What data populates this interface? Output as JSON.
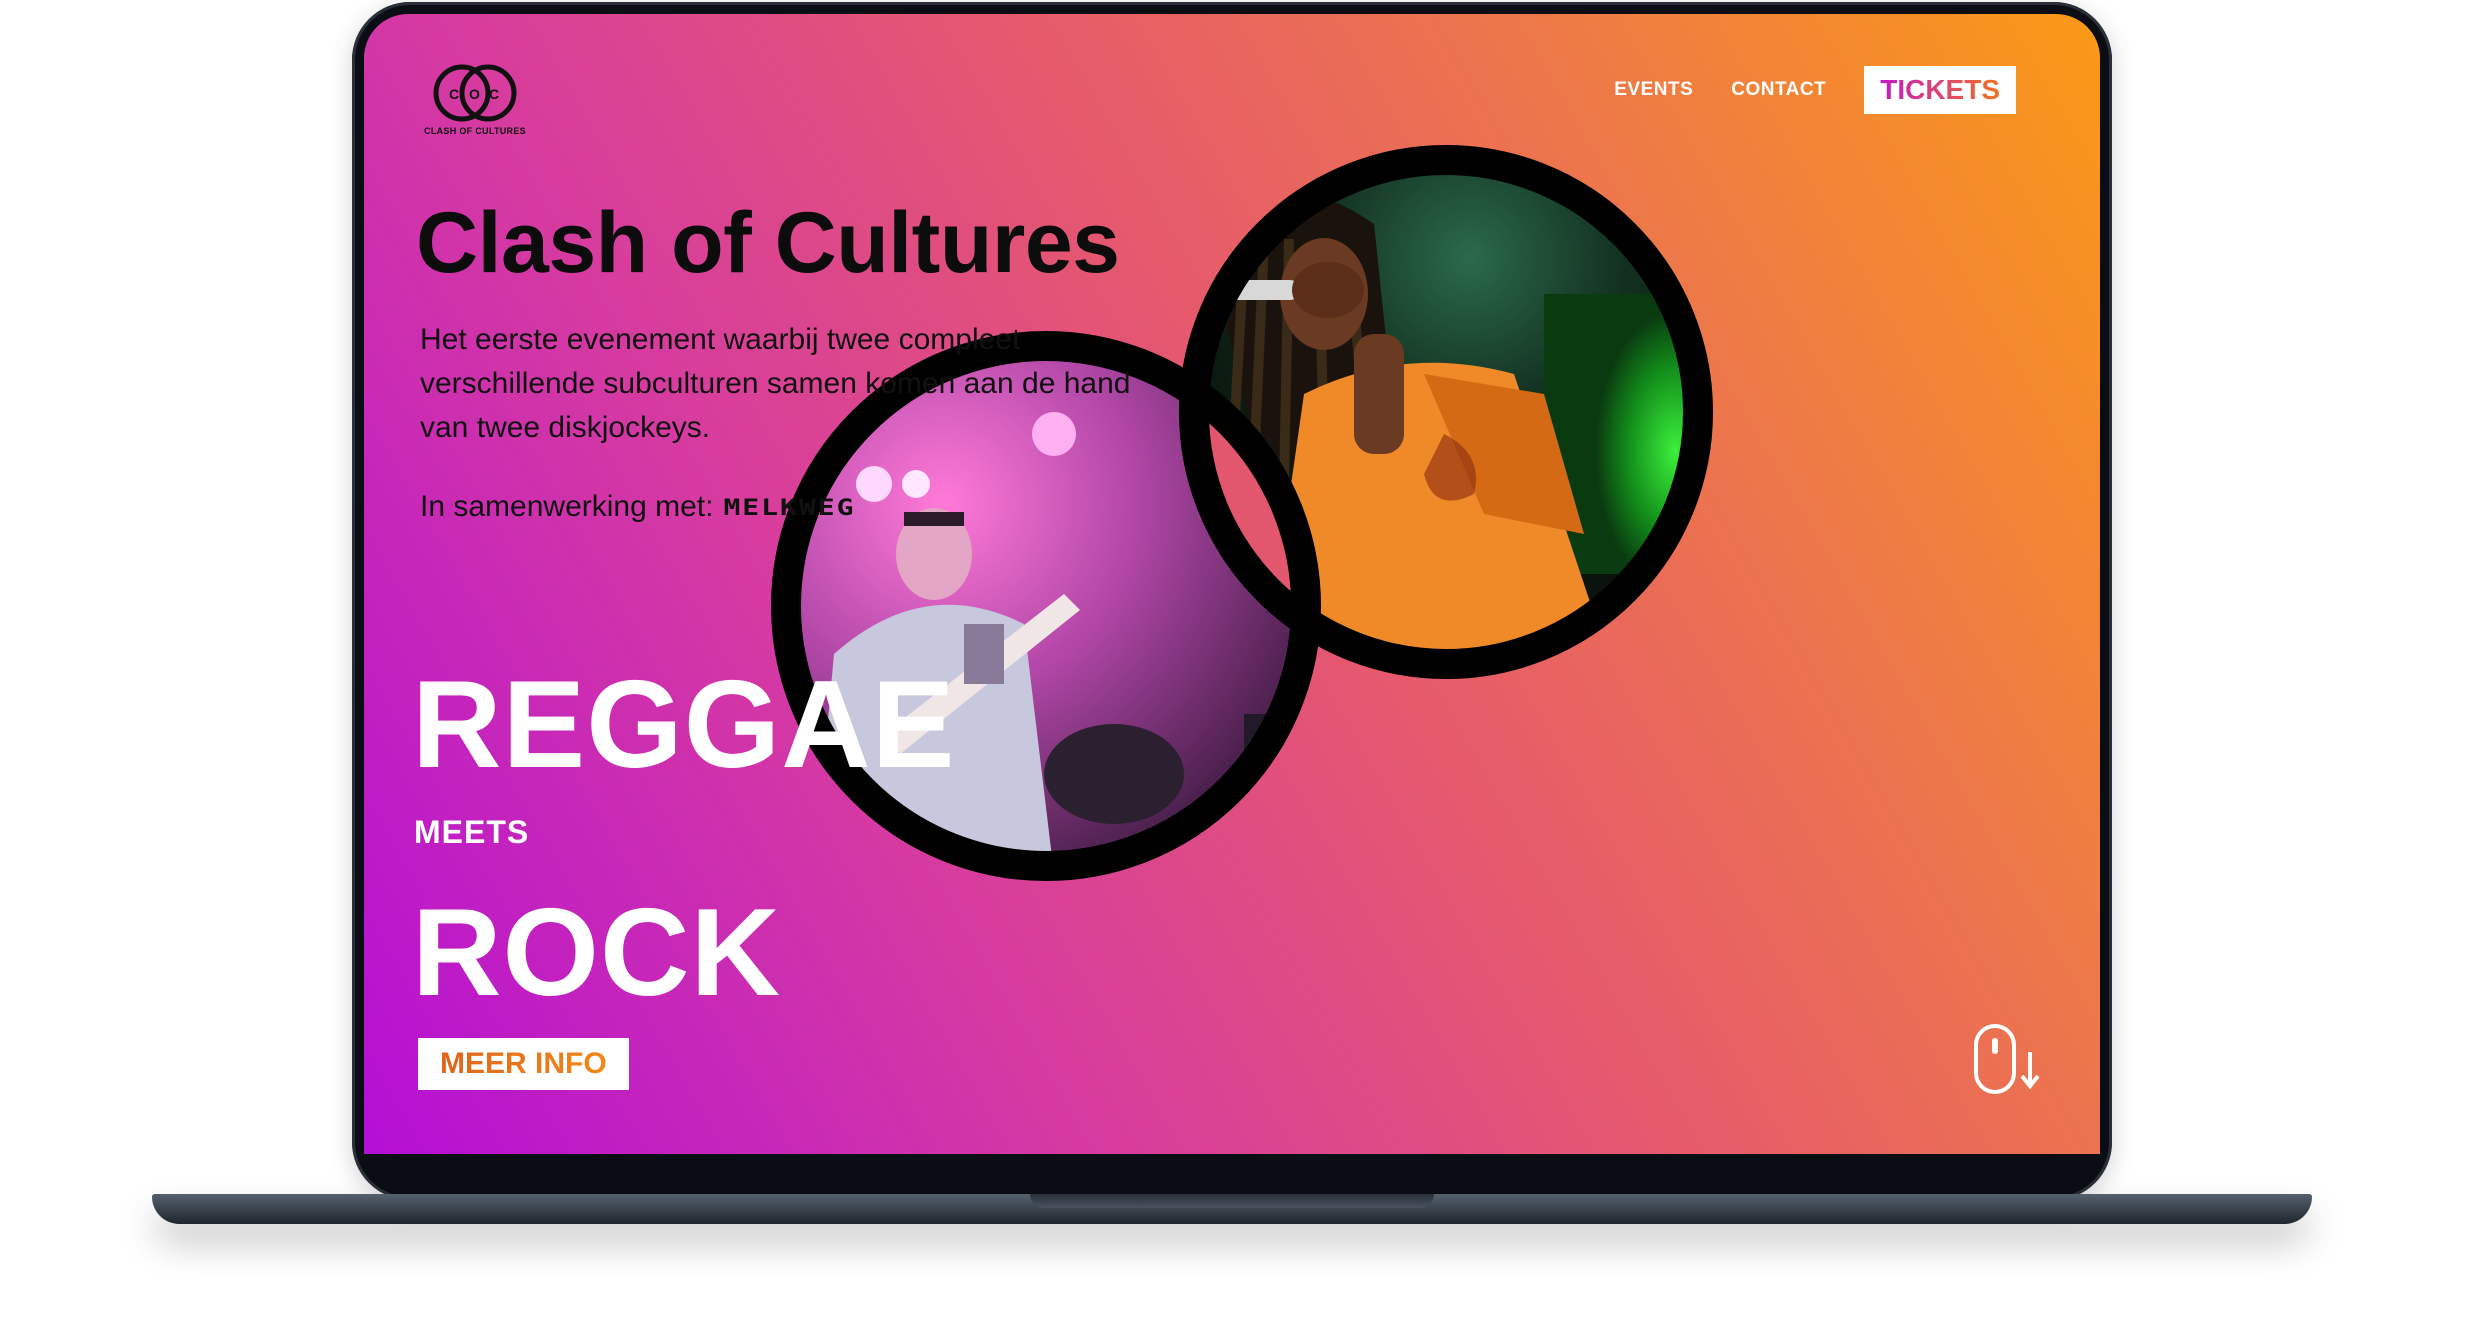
{
  "brand": {
    "logo_letters": [
      "C",
      "O",
      "C"
    ],
    "logo_caption": "CLASH OF CULTURES"
  },
  "nav": {
    "items": [
      {
        "label": "EVENTS"
      },
      {
        "label": "CONTACT"
      }
    ],
    "tickets_label": "TICKETS"
  },
  "hero": {
    "title": "Clash of Cultures",
    "intro": "Het eerste evenement waarbij twee compleet verschillende subculturen samen komen aan de hand van twee diskjockeys.",
    "collab_label": "In samenwerking met:",
    "collab_partner": "MELKWEG",
    "genre_one": "REGGAE",
    "connector": "MEETS",
    "genre_two": "ROCK",
    "cta_label": "MEER INFO"
  },
  "icons": {
    "scroll": "mouse-scroll-down-icon"
  },
  "colors": {
    "gradient_start": "#b40fd6",
    "gradient_mid": "#e65a6c",
    "gradient_end": "#fb9915",
    "text_dark": "#0c0c0c",
    "text_light": "#ffffff",
    "ring": "#000000"
  }
}
